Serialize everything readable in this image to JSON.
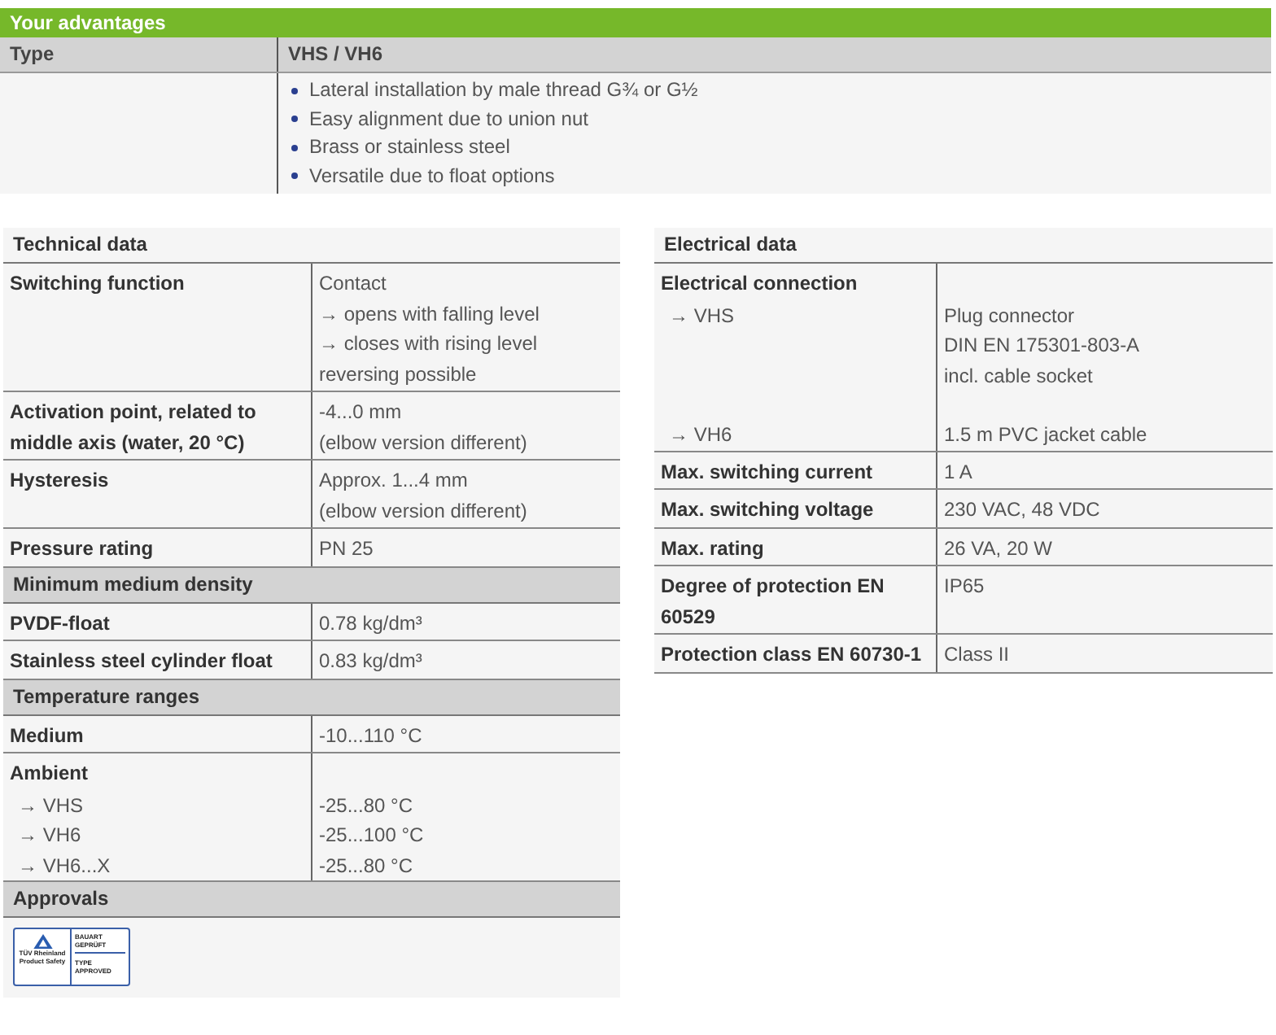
{
  "advantages": {
    "title": "Your advantages",
    "columns": [
      "Type",
      "VHS / VH6"
    ],
    "bullets": [
      "Lateral installation by male thread G¾ or G½",
      "Easy alignment due to union nut",
      "Brass or stainless steel",
      "Versatile due to float options"
    ]
  },
  "tables": [
    {
      "rows": [
        {
          "kind": "title",
          "label": "Technical data"
        },
        {
          "kind": "row",
          "label": "Switching function",
          "value": [
            "Contact",
            "→ opens with falling level",
            "→ closes with rising level",
            "reversing possible"
          ]
        },
        {
          "kind": "row",
          "label": "Activation point, related to middle axis (water, 20 °C)",
          "value": [
            "-4...0 mm",
            "(elbow version different)"
          ]
        },
        {
          "kind": "row",
          "label": "Hysteresis",
          "value": [
            "Approx. 1...4 mm",
            "(elbow version different)"
          ]
        },
        {
          "kind": "row",
          "label": "Pressure rating",
          "value": [
            "PN 25"
          ]
        },
        {
          "kind": "heading",
          "label": "Minimum medium density"
        },
        {
          "kind": "row",
          "label": "PVDF-float",
          "value": [
            "0.78 kg/dm³"
          ]
        },
        {
          "kind": "row",
          "label": "Stainless steel cylinder float",
          "value": [
            "0.83 kg/dm³"
          ]
        },
        {
          "kind": "heading",
          "label": "Temperature ranges"
        },
        {
          "kind": "row",
          "label": "Medium",
          "value": [
            "-10...110 °C"
          ]
        },
        {
          "kind": "row",
          "label": "Ambient",
          "items": [
            {
              "label": "→ VHS",
              "value": [
                "-25...80 °C"
              ]
            },
            {
              "label": "→ VH6",
              "value": [
                "-25...100 °C"
              ]
            },
            {
              "label": "→ VH6...X",
              "value": [
                "-25...80 °C"
              ]
            }
          ]
        },
        {
          "kind": "heading",
          "label": "Approvals"
        },
        {
          "kind": "logo",
          "logo": {
            "left": "TÜV Rheinland Product Safety",
            "right_top": "BAUART GEPRÜFT",
            "right_bottom": "TYPE APPROVED"
          }
        }
      ]
    },
    {
      "rows": [
        {
          "kind": "title",
          "label": "Electrical data"
        },
        {
          "kind": "row",
          "label": "Electrical connection",
          "items": [
            {
              "label": "→ VHS",
              "value": [
                "Plug connector",
                "DIN EN 175301-803-A",
                "incl. cable socket"
              ]
            },
            {
              "label": "→ VH6",
              "value": [
                "1.5 m PVC jacket cable"
              ]
            }
          ]
        },
        {
          "kind": "row",
          "label": "Max. switching current",
          "value": [
            "1 A"
          ]
        },
        {
          "kind": "row",
          "label": "Max. switching voltage",
          "value": [
            "230 VAC, 48 VDC"
          ]
        },
        {
          "kind": "row",
          "label": "Max. rating",
          "value": [
            "26 VA, 20 W"
          ]
        },
        {
          "kind": "row",
          "label": "Degree of protection EN 60529",
          "value": [
            "IP65"
          ]
        },
        {
          "kind": "row",
          "label": "Protection class EN 60730-1",
          "value": [
            "Class II"
          ]
        }
      ]
    }
  ]
}
